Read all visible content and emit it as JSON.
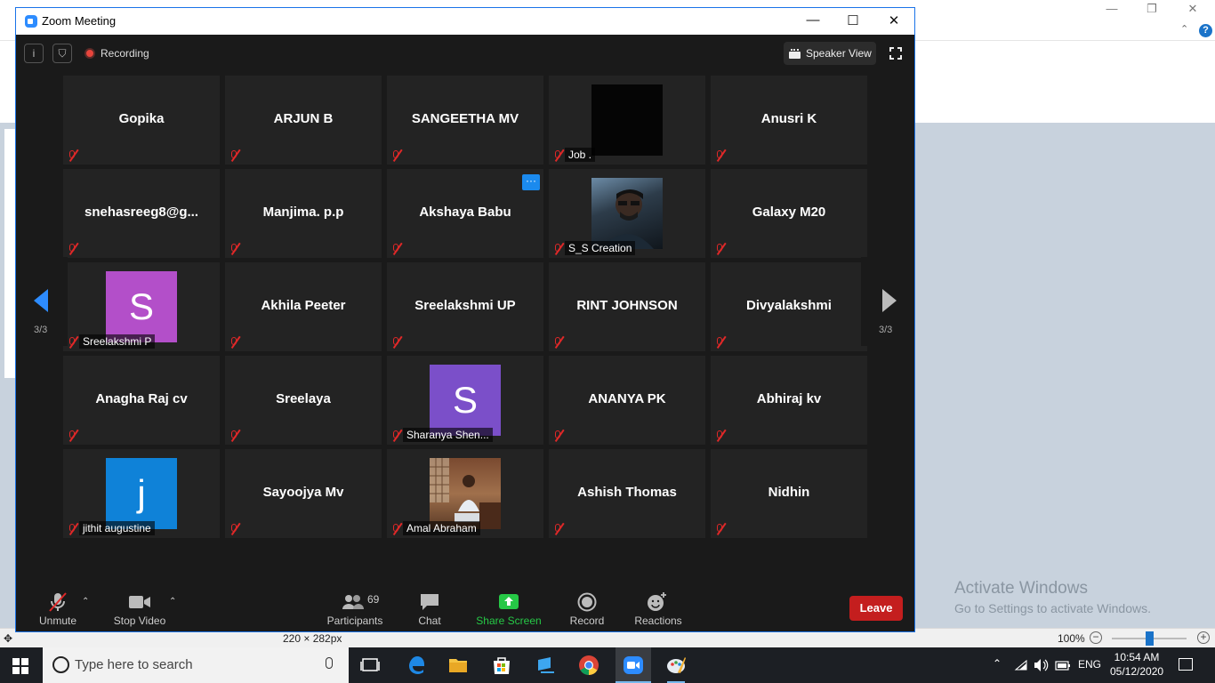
{
  "window": {
    "title": "Zoom Meeting",
    "minimize": "—",
    "maximize": "☐",
    "close": "✕"
  },
  "topbar": {
    "recording": "Recording",
    "speaker_view": "Speaker View",
    "info_icon": "info-icon",
    "shield_icon": "shield-icon"
  },
  "participants": [
    {
      "name": "Gopika",
      "type": "text"
    },
    {
      "name": "ARJUN B",
      "type": "text"
    },
    {
      "name": "SANGEETHA MV",
      "type": "text"
    },
    {
      "name": "Job .",
      "type": "video-black"
    },
    {
      "name": "Anusri K",
      "type": "text"
    },
    {
      "name": "snehasreeg8@g...",
      "type": "text"
    },
    {
      "name": "Manjima. p.p",
      "type": "text"
    },
    {
      "name": "Akshaya Babu",
      "type": "text",
      "more": "···"
    },
    {
      "name": "S_S Creation",
      "type": "photo-man"
    },
    {
      "name": "Galaxy M20",
      "type": "text"
    },
    {
      "name": "Sreelakshmi P",
      "type": "avatar",
      "initial": "S",
      "color": "#b34fc9"
    },
    {
      "name": "Akhila Peeter",
      "type": "text"
    },
    {
      "name": "Sreelakshmi UP",
      "type": "text"
    },
    {
      "name": "RINT JOHNSON",
      "type": "text"
    },
    {
      "name": "Divyalakshmi",
      "type": "text"
    },
    {
      "name": "Anagha Raj cv",
      "type": "text"
    },
    {
      "name": "Sreelaya",
      "type": "text"
    },
    {
      "name": "Sharanya Shen...",
      "type": "avatar",
      "initial": "S",
      "color": "#7b4fc9"
    },
    {
      "name": "ANANYA PK",
      "type": "text"
    },
    {
      "name": "Abhiraj kv",
      "type": "text"
    },
    {
      "name": "jithit augustine",
      "type": "avatar",
      "initial": "j",
      "color": "#0f82d8"
    },
    {
      "name": "Sayoojya Mv",
      "type": "text"
    },
    {
      "name": "Amal Abraham",
      "type": "photo-room"
    },
    {
      "name": "Ashish Thomas",
      "type": "text"
    },
    {
      "name": "Nidhin",
      "type": "text"
    }
  ],
  "pagination": {
    "left": "3/3",
    "right": "3/3"
  },
  "toolbar": {
    "unmute": "Unmute",
    "stop_video": "Stop Video",
    "participants": "Participants",
    "participants_count": "69",
    "chat": "Chat",
    "share_screen": "Share Screen",
    "record": "Record",
    "reactions": "Reactions",
    "leave": "Leave"
  },
  "background": {
    "status_size": "220 × 282px",
    "zoom_level": "100%",
    "watermark_line1": "Activate Windows",
    "watermark_line2": "Go to Settings to activate Windows."
  },
  "taskbar": {
    "search_placeholder": "Type here to search",
    "language": "ENG",
    "time": "10:54 AM",
    "date": "05/12/2020"
  },
  "colors": {
    "accent": "#2d8cff",
    "share": "#26c846",
    "leave": "#c41e1e",
    "muted": "#e02828"
  }
}
